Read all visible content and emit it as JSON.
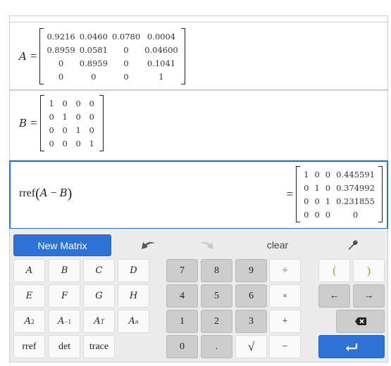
{
  "expressions": [
    {
      "name": "A",
      "equals": "=",
      "rows": [
        [
          "0.9216",
          "0.0460",
          "0.0780",
          "0.0004"
        ],
        [
          "0.8959",
          "0.0581",
          "0",
          "0.04600"
        ],
        [
          "0",
          "0.8959",
          "0",
          "0.1041"
        ],
        [
          "0",
          "0",
          "0",
          "1"
        ]
      ]
    },
    {
      "name": "B",
      "equals": "=",
      "rows": [
        [
          "1",
          "0",
          "0",
          "0"
        ],
        [
          "0",
          "1",
          "0",
          "0"
        ],
        [
          "0",
          "0",
          "1",
          "0"
        ],
        [
          "0",
          "0",
          "0",
          "1"
        ]
      ]
    },
    {
      "func": "rref",
      "open": "(",
      "arg1": "A",
      "op": "−",
      "arg2": "B",
      "close": ")",
      "equals": "=",
      "result_rows": [
        [
          "1",
          "0",
          "0",
          "0.445591"
        ],
        [
          "0",
          "1",
          "0",
          "0.374992"
        ],
        [
          "0",
          "0",
          "1",
          "0.231855"
        ],
        [
          "0",
          "0",
          "0",
          "0"
        ]
      ]
    }
  ],
  "keypad": {
    "new_matrix": "New Matrix",
    "undo_icon": "undo-icon",
    "redo_icon": "redo-icon",
    "clear": "clear",
    "settings_icon": "wrench-icon",
    "matrix_keys": [
      "A",
      "B",
      "C",
      "D",
      "E",
      "F",
      "G",
      "H"
    ],
    "power_keys": [
      {
        "base": "A",
        "exp": "2"
      },
      {
        "base": "A",
        "exp": "−1"
      },
      {
        "base": "A",
        "exp": "T"
      },
      {
        "base": "A",
        "exp": "n"
      }
    ],
    "func_keys": [
      "rref",
      "det",
      "trace"
    ],
    "digits": [
      "7",
      "8",
      "9",
      "4",
      "5",
      "6",
      "1",
      "2",
      "3",
      "0",
      "."
    ],
    "ops": {
      "divide": "÷",
      "times": "×",
      "plus": "+",
      "minus": "−",
      "sqrt": "√"
    },
    "parens": [
      "(",
      ")"
    ],
    "arrows": {
      "left": "←",
      "right": "→"
    },
    "backspace_icon": "backspace-icon",
    "enter_icon": "enter-icon"
  },
  "colors": {
    "accent": "#2f72d6",
    "keypad_bg": "#ececec",
    "gray_key": "#cdcdcd",
    "white_key": "#fafafa"
  }
}
